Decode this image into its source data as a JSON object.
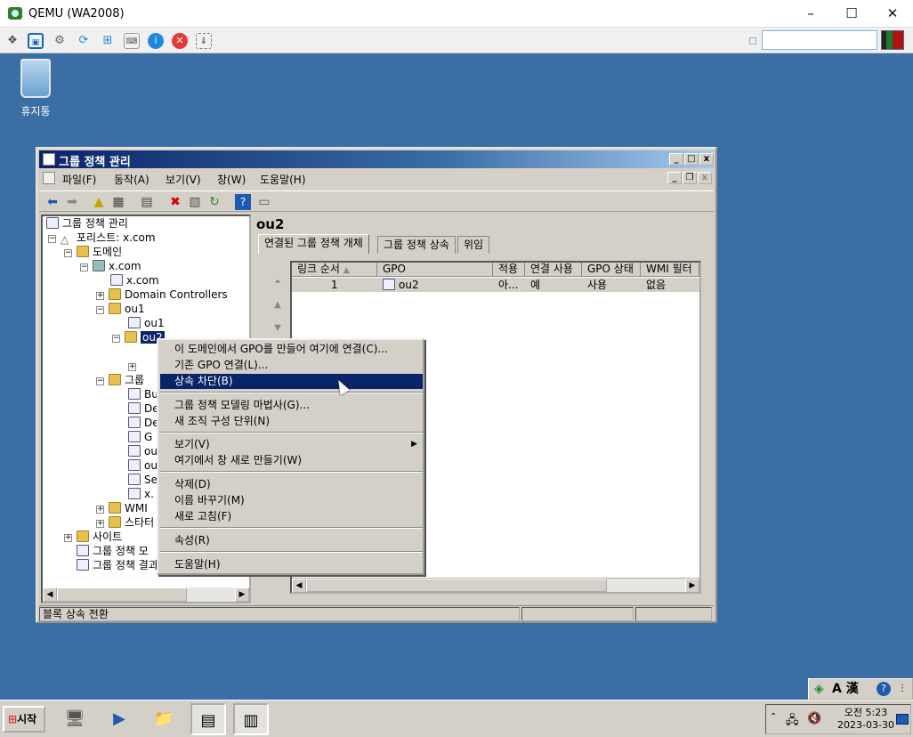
{
  "qemu": {
    "title": "QEMU (WA2008)",
    "minimize_icon": "–",
    "maximize_icon": "☐",
    "close_icon": "✕"
  },
  "desktop": {
    "recycle_label": "휴지통"
  },
  "gpm": {
    "title": "그룹 정책 관리",
    "menu": [
      "파일(F)",
      "동작(A)",
      "보기(V)",
      "창(W)",
      "도움말(H)"
    ],
    "tree": {
      "root": "그룹 정책 관리",
      "forest": "포리스트: x.com",
      "domains": "도메인",
      "domain": "x.com",
      "gpo_link": "x.com",
      "dc": "Domain Controllers",
      "ou1": "ou1",
      "ou1_child": "ou1",
      "ou2": "ou2",
      "groups": "그룹",
      "items": [
        "Bu",
        "De",
        "De",
        "G",
        "ou",
        "ou",
        "Se",
        "x."
      ],
      "wmi": "WMI",
      "starter": "스타터",
      "sites": "사이트",
      "modeling": "그룹 정책 모",
      "results": "그룹 정책 결과"
    },
    "right": {
      "title": "ou2",
      "tabs": [
        "연결된 그룹 정책 개체",
        "그룹 정책 상속",
        "위임"
      ],
      "columns": [
        "링크 순서",
        "GPO",
        "적용",
        "연결 사용",
        "GPO 상태",
        "WMI 필터"
      ],
      "row": [
        "1",
        "ou2",
        "아...",
        "예",
        "사용",
        "없음"
      ]
    },
    "status": "블록 상속 전환"
  },
  "context_menu": [
    "이 도메인에서 GPO를 만들어 여기에 연결(C)...",
    "기존 GPO 연결(L)...",
    "상속 차단(B)",
    "그룹 정책 모델링 마법사(G)...",
    "새 조직 구성 단위(N)",
    "보기(V)",
    "여기에서 창 새로 만들기(W)",
    "삭제(D)",
    "이름 바꾸기(M)",
    "새로 고침(F)",
    "속성(R)",
    "도움말(H)"
  ],
  "taskbar": {
    "start": "시작",
    "lang": "A 漢",
    "time": "오전 5:23",
    "date": "2023-03-30"
  }
}
